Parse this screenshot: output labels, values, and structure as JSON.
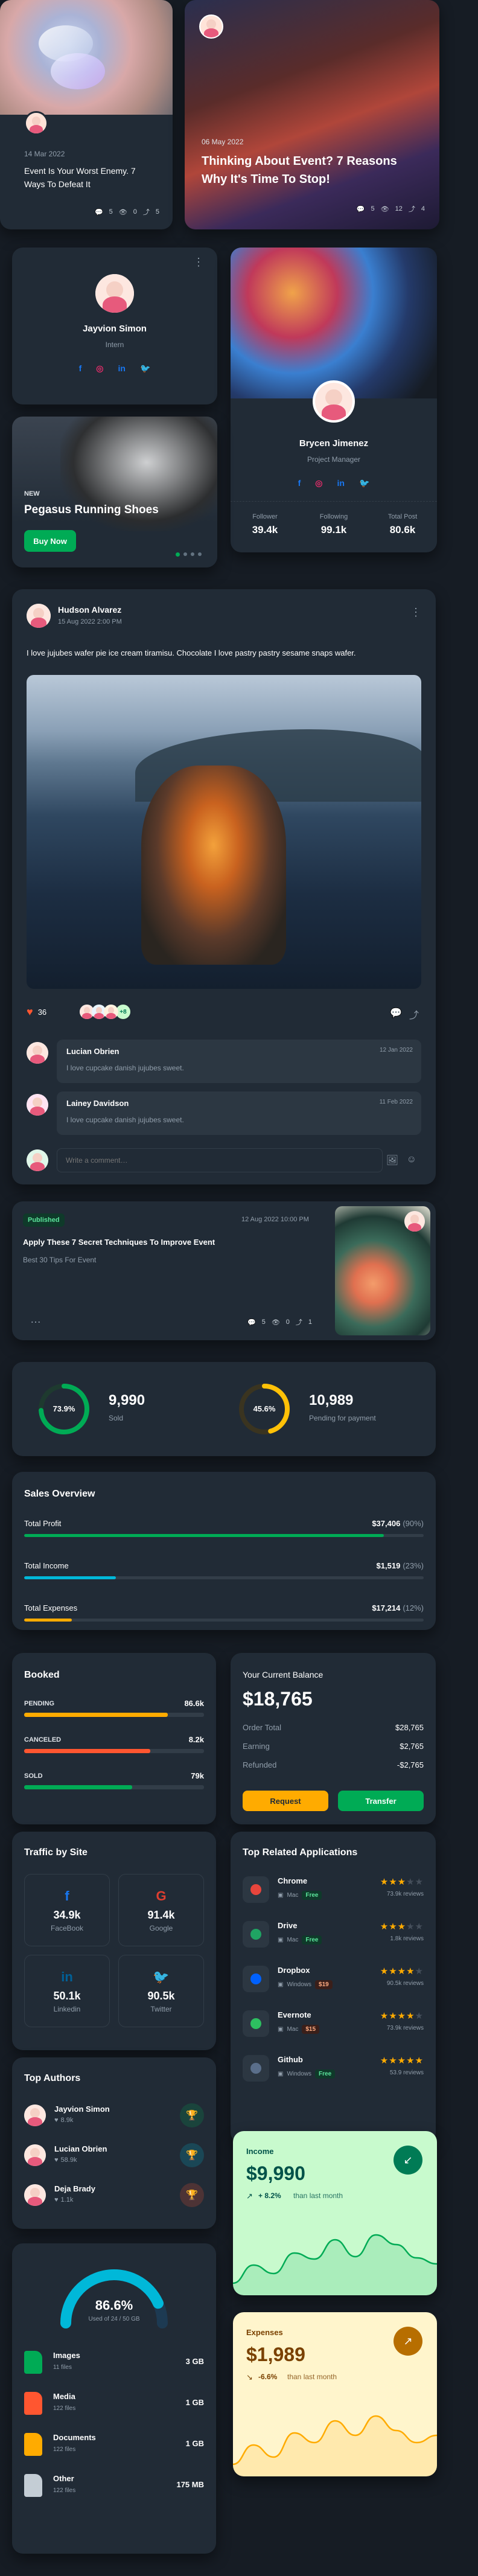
{
  "post_card_small": {
    "date": "14 Mar 2022",
    "title": "Event Is Your Worst Enemy. 7 Ways To Defeat It",
    "comments": "5",
    "views": "0",
    "shares": "5"
  },
  "post_card_large": {
    "date": "06 May 2022",
    "title": "Thinking About Event? 7 Reasons Why It's Time To Stop!",
    "comments": "5",
    "views": "12",
    "shares": "4"
  },
  "user_card_small": {
    "name": "Jayvion Simon",
    "role": "Intern"
  },
  "user_card_large": {
    "name": "Brycen Jimenez",
    "role": "Project Manager",
    "stats": [
      {
        "label": "Follower",
        "value": "39.4k"
      },
      {
        "label": "Following",
        "value": "99.1k"
      },
      {
        "label": "Total Post",
        "value": "80.6k"
      }
    ]
  },
  "promo": {
    "badge": "NEW",
    "title": "Pegasus Running Shoes",
    "button": "Buy Now"
  },
  "feed": {
    "author": "Hudson Alvarez",
    "date": "15 Aug 2022 2:00 PM",
    "text": "I love jujubes wafer pie ice cream tiramisu. Chocolate I love pastry pastry sesame snaps wafer.",
    "likes": "36",
    "more_count": "+8",
    "comments": [
      {
        "name": "Lucian Obrien",
        "date": "12 Jan 2022",
        "text": "I love cupcake danish jujubes sweet."
      },
      {
        "name": "Lainey Davidson",
        "date": "11 Feb 2022",
        "text": "I love cupcake danish jujubes sweet."
      }
    ],
    "comment_placeholder": "Write a comment…"
  },
  "article": {
    "badge": "Published",
    "date": "12 Aug 2022 10:00 PM",
    "title": "Apply These 7 Secret Techniques To Improve Event",
    "subtitle": "Best 30 Tips For Event",
    "comments": "5",
    "views": "0",
    "shares": "1"
  },
  "progress_summary": [
    {
      "percent": 73.9,
      "percent_label": "73.9%",
      "value": "9,990",
      "label": "Sold",
      "color": "#00ab55"
    },
    {
      "percent": 45.6,
      "percent_label": "45.6%",
      "value": "10,989",
      "label": "Pending for payment",
      "color": "#ffc107"
    }
  ],
  "sales_overview": {
    "title": "Sales Overview",
    "items": [
      {
        "label": "Total Profit",
        "amount": "$37,406",
        "pct": "(90%)",
        "fraction": 0.9,
        "color": "#00ab55"
      },
      {
        "label": "Total Income",
        "amount": "$1,519",
        "pct": "(23%)",
        "fraction": 0.23,
        "color": "#00b8d9"
      },
      {
        "label": "Total Expenses",
        "amount": "$17,214",
        "pct": "(12%)",
        "fraction": 0.12,
        "color": "#ffab00"
      }
    ]
  },
  "booked": {
    "title": "Booked",
    "items": [
      {
        "label": "PENDING",
        "value": "86.6k",
        "fraction": 0.8,
        "color": "#ffab00"
      },
      {
        "label": "CANCELED",
        "value": "8.2k",
        "fraction": 0.7,
        "color": "#ff5630"
      },
      {
        "label": "SOLD",
        "value": "79k",
        "fraction": 0.6,
        "color": "#00ab55"
      }
    ]
  },
  "balance": {
    "title": "Your Current Balance",
    "amount": "$18,765",
    "rows": [
      {
        "label": "Order Total",
        "value": "$28,765"
      },
      {
        "label": "Earning",
        "value": "$2,765"
      },
      {
        "label": "Refunded",
        "value": "-$2,765"
      }
    ],
    "request": "Request",
    "transfer": "Transfer"
  },
  "traffic": {
    "title": "Traffic by Site",
    "sites": [
      {
        "icon": "facebook-icon",
        "glyph": "f",
        "value": "34.9k",
        "name": "FaceBook",
        "color": "#1877f2"
      },
      {
        "icon": "google-icon",
        "glyph": "G",
        "value": "91.4k",
        "name": "Google",
        "color": "#df3e30"
      },
      {
        "icon": "linkedin-icon",
        "glyph": "in",
        "value": "50.1k",
        "name": "Linkedin",
        "color": "#006097"
      },
      {
        "icon": "twitter-icon",
        "glyph": "🐦",
        "value": "90.5k",
        "name": "Twitter",
        "color": "#1c9cea"
      }
    ]
  },
  "apps": {
    "title": "Top Related Applications",
    "items": [
      {
        "name": "Chrome",
        "platform": "Mac",
        "price": "Free",
        "free": true,
        "reviews": "73.9k reviews",
        "stars": 3,
        "icon": "chrome-icon",
        "color": "#e8453c"
      },
      {
        "name": "Drive",
        "platform": "Mac",
        "price": "Free",
        "free": true,
        "reviews": "1.8k reviews",
        "stars": 3,
        "icon": "drive-icon",
        "color": "#1fa463"
      },
      {
        "name": "Dropbox",
        "platform": "Windows",
        "price": "$19",
        "free": false,
        "reviews": "90.5k reviews",
        "stars": 4,
        "icon": "dropbox-icon",
        "color": "#0061fe"
      },
      {
        "name": "Evernote",
        "platform": "Mac",
        "price": "$15",
        "free": false,
        "reviews": "73.9k reviews",
        "stars": 4,
        "icon": "evernote-icon",
        "color": "#2dbe60"
      },
      {
        "name": "Github",
        "platform": "Windows",
        "price": "Free",
        "free": true,
        "reviews": "53.9 reviews",
        "stars": 5,
        "icon": "github-icon",
        "color": "#5a6e8a"
      }
    ]
  },
  "authors": {
    "title": "Top Authors",
    "items": [
      {
        "name": "Jayvion Simon",
        "likes": "8.9k",
        "trophy": "#00ab55"
      },
      {
        "name": "Lucian Obrien",
        "likes": "58.9k",
        "trophy": "#00b8d9"
      },
      {
        "name": "Deja Brady",
        "likes": "1.1k",
        "trophy": "#ff5630"
      }
    ]
  },
  "income": {
    "label": "Income",
    "amount": "$9,990",
    "delta": "+ 8.2%",
    "note": "than last month",
    "series": [
      2,
      3.5,
      2.8,
      4.5,
      4,
      5.6,
      4.2,
      6,
      5.2,
      4.1,
      3.6
    ]
  },
  "expenses": {
    "label": "Expenses",
    "amount": "$1,989",
    "delta": "-6.6%",
    "note": "than last month",
    "series": [
      2,
      3.6,
      2.6,
      4.6,
      3.8,
      5.6,
      4.4,
      6,
      4.8,
      3.8,
      4.4
    ]
  },
  "storage": {
    "percent": 86.6,
    "percent_label": "86.6%",
    "used": "Used of 24 / 50 GB",
    "items": [
      {
        "name": "Images",
        "files": "11 files",
        "size": "3 GB",
        "icon": "image-file-icon",
        "color": "#00ab55"
      },
      {
        "name": "Media",
        "files": "122 files",
        "size": "1 GB",
        "icon": "media-file-icon",
        "color": "#ff5630"
      },
      {
        "name": "Documents",
        "files": "122 files",
        "size": "1 GB",
        "icon": "document-file-icon",
        "color": "#ffab00"
      },
      {
        "name": "Other",
        "files": "122 files",
        "size": "175 MB",
        "icon": "other-file-icon",
        "color": "#c4cdd5"
      }
    ]
  }
}
